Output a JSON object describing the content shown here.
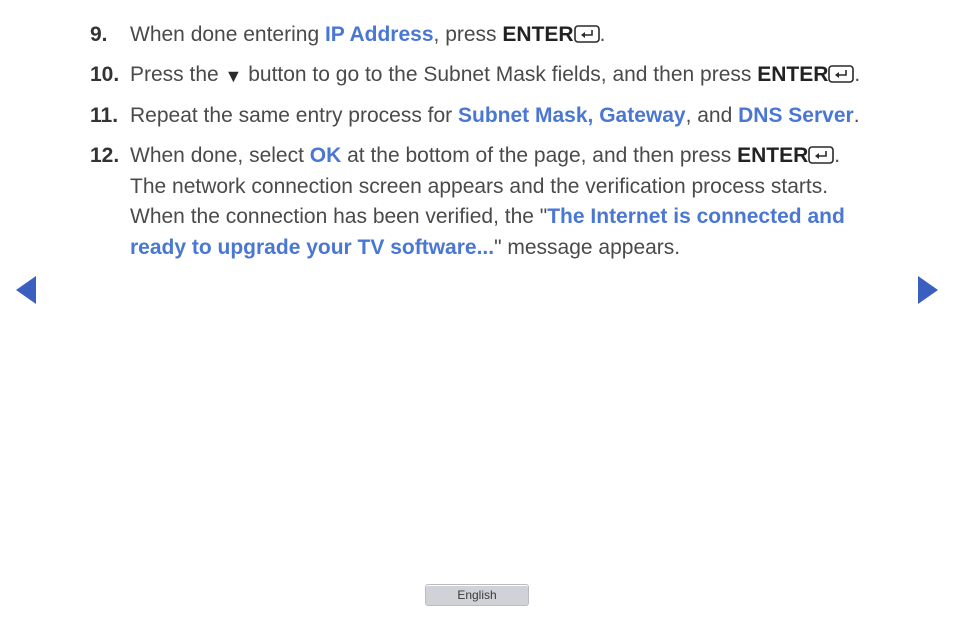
{
  "steps": [
    {
      "num": "9.",
      "parts": [
        {
          "t": "text",
          "v": "When done entering "
        },
        {
          "t": "hl",
          "v": "IP Address"
        },
        {
          "t": "text",
          "v": ", press "
        },
        {
          "t": "bold",
          "v": "ENTER"
        },
        {
          "t": "enter-icon"
        },
        {
          "t": "text",
          "v": "."
        }
      ]
    },
    {
      "num": "10.",
      "parts": [
        {
          "t": "text",
          "v": "Press the "
        },
        {
          "t": "tri-down"
        },
        {
          "t": "text",
          "v": " button to go to the Subnet Mask fields, and then press "
        },
        {
          "t": "bold",
          "v": "ENTER"
        },
        {
          "t": "enter-icon"
        },
        {
          "t": "text",
          "v": "."
        }
      ]
    },
    {
      "num": "11.",
      "parts": [
        {
          "t": "text",
          "v": "Repeat the same entry process for "
        },
        {
          "t": "hl",
          "v": "Subnet Mask, Gateway"
        },
        {
          "t": "text",
          "v": ", and "
        },
        {
          "t": "hl",
          "v": "DNS Server"
        },
        {
          "t": "text",
          "v": "."
        }
      ]
    },
    {
      "num": "12.",
      "parts": [
        {
          "t": "text",
          "v": "When done, select "
        },
        {
          "t": "hl",
          "v": "OK"
        },
        {
          "t": "text",
          "v": " at the bottom of the page, and then press "
        },
        {
          "t": "bold",
          "v": "ENTER"
        },
        {
          "t": "enter-icon"
        },
        {
          "t": "text",
          "v": ". The network connection screen appears and the verification process starts. When the connection has been verified, the \""
        },
        {
          "t": "hl",
          "v": "The Internet is connected and ready to upgrade your TV software..."
        },
        {
          "t": "text",
          "v": "\" message appears."
        }
      ]
    }
  ],
  "language_label": "English"
}
